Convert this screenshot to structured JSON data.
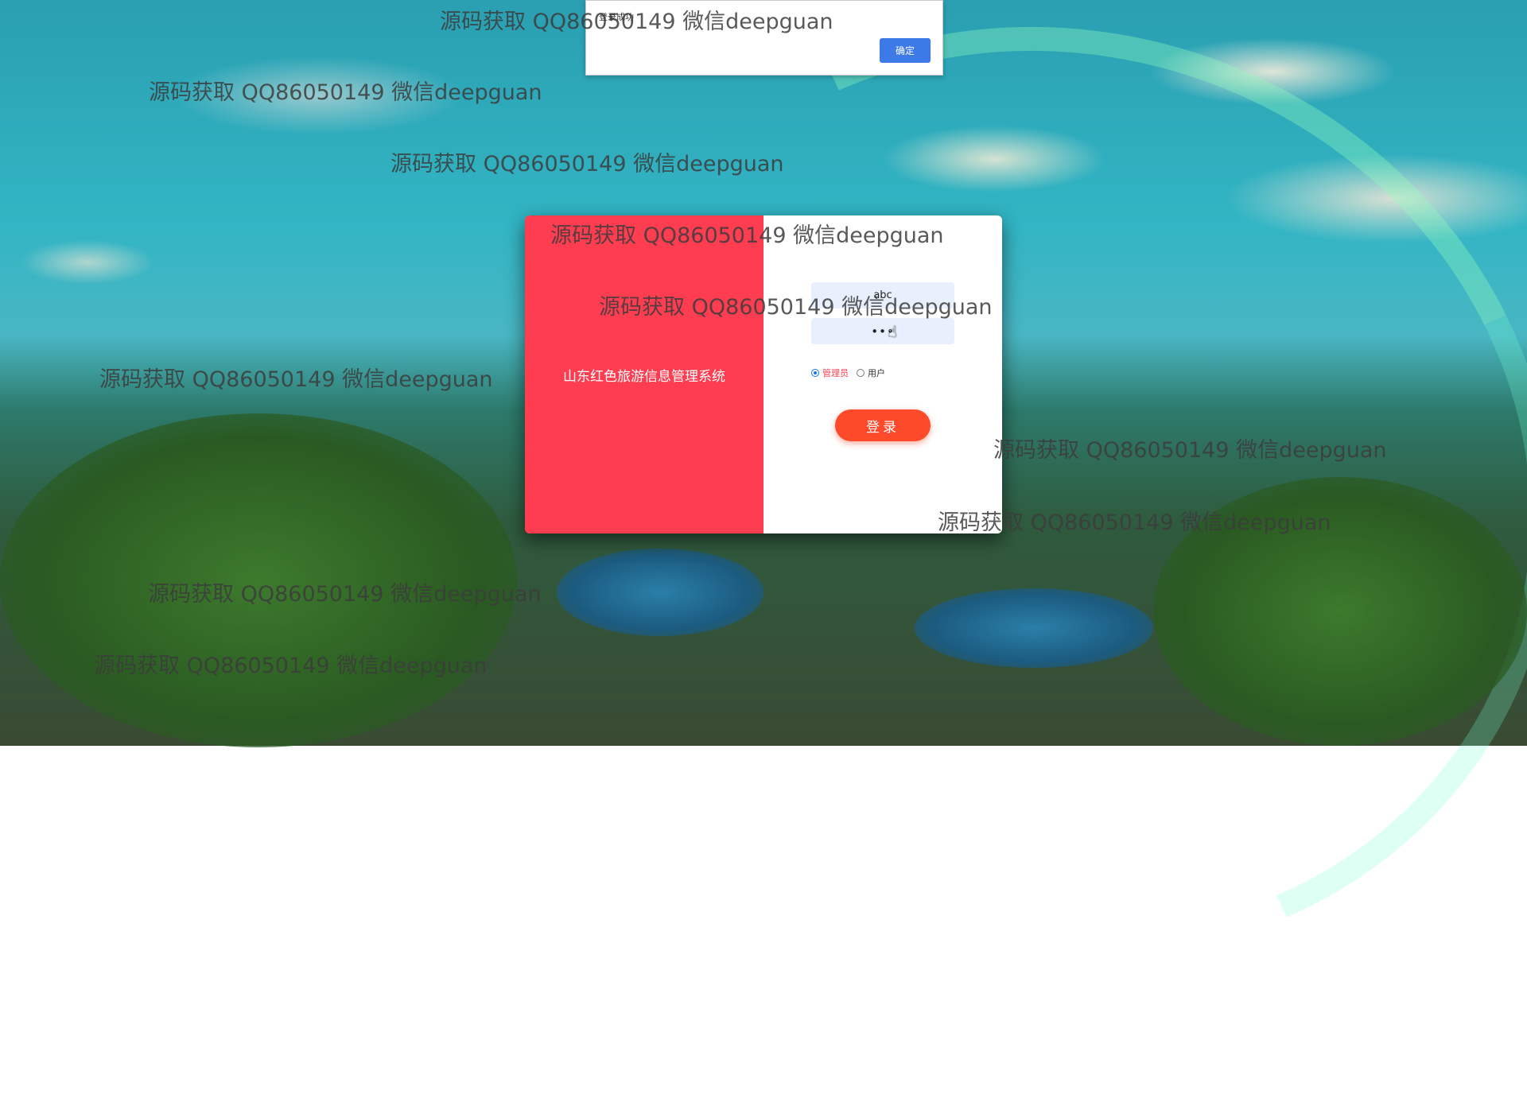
{
  "alert": {
    "message": "登录成功",
    "ok_label": "确定"
  },
  "login": {
    "system_title": "山东红色旅游信息管理系统",
    "username_value": "abc",
    "password_value": "•••",
    "roles": [
      {
        "label": "管理员",
        "checked": true
      },
      {
        "label": "用户",
        "checked": false
      }
    ],
    "submit_label": "登录"
  },
  "watermark_text": "源码获取 QQ86050149 微信deepguan",
  "colors": {
    "left_panel": "#ff3d51",
    "login_button": "#fd4a2b",
    "alert_button": "#3c7be7",
    "input_bg": "#e8f0fe"
  }
}
